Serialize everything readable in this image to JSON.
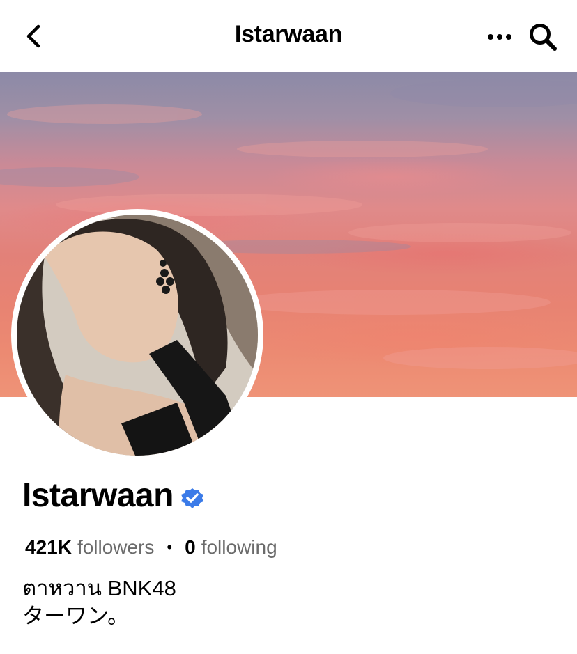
{
  "header": {
    "title": "Istarwaan"
  },
  "profile": {
    "name": "Istarwaan",
    "followers_count": "421K",
    "followers_label": "followers",
    "separator": "•",
    "following_count": "0",
    "following_label": "following",
    "bio_line1": "ตาหวาน BNK48",
    "bio_line2": "ターワン。"
  },
  "colors": {
    "verified": "#3b7be8",
    "muted_text": "#6b6b6b"
  },
  "icons": {
    "back": "chevron-left-icon",
    "more": "more-horizontal-icon",
    "search": "search-icon",
    "verified": "verified-badge-icon"
  }
}
